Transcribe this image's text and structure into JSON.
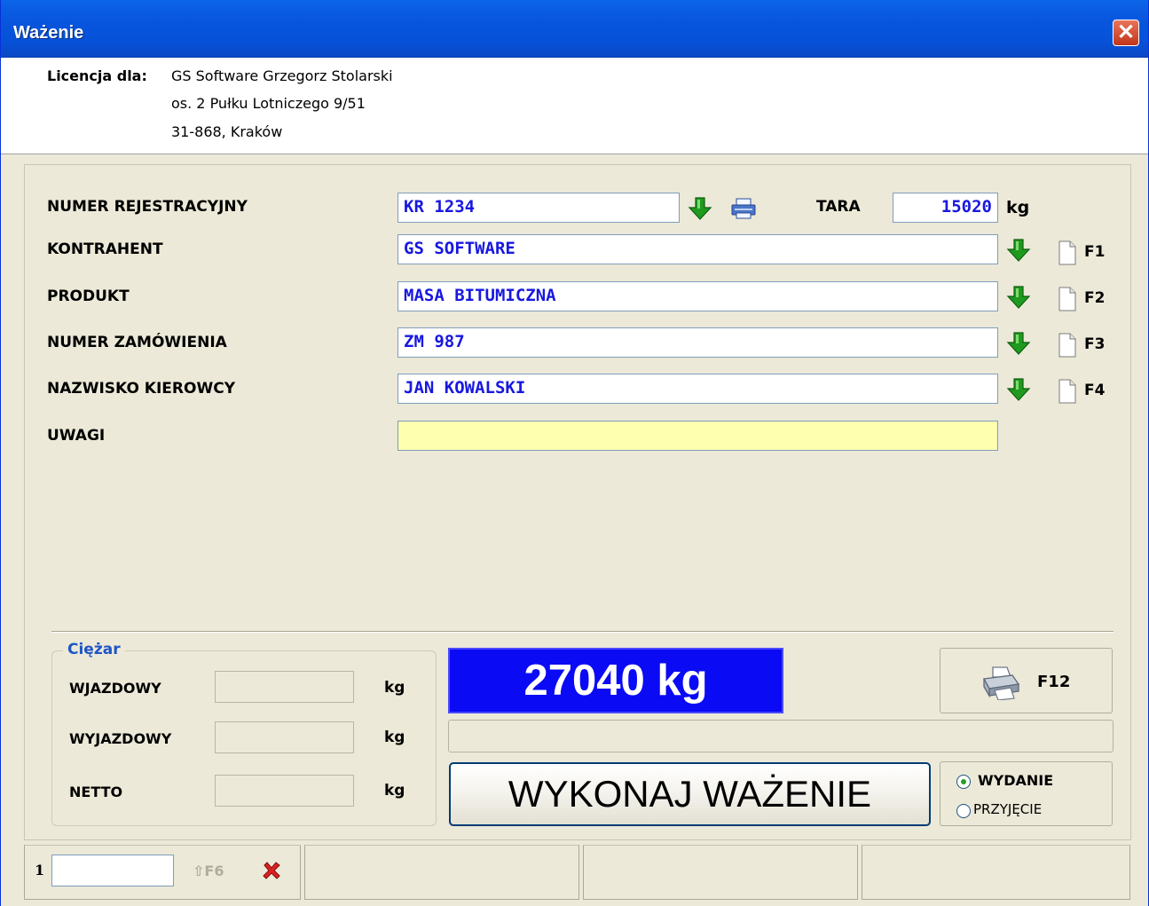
{
  "window": {
    "title": "Ważenie",
    "close_label": "✕"
  },
  "license": {
    "label": "Licencja dla:",
    "lines": [
      "GS Software Grzegorz Stolarski",
      "os. 2 Pułku Lotniczego 9/51",
      "31-868, Kraków"
    ]
  },
  "form": {
    "registration": {
      "label": "NUMER REJESTRACYJNY",
      "value": "KR 1234"
    },
    "tara": {
      "label": "TARA",
      "value": "15020",
      "unit": "kg"
    },
    "contractor": {
      "label": "KONTRAHENT",
      "value": "GS SOFTWARE",
      "key": "F1"
    },
    "product": {
      "label": "PRODUKT",
      "value": "MASA BITUMICZNA",
      "key": "F2"
    },
    "order": {
      "label": "NUMER ZAMÓWIENIA",
      "value": "ZM 987",
      "key": "F3"
    },
    "driver": {
      "label": "NAZWISKO KIEROWCY",
      "value": "JAN KOWALSKI",
      "key": "F4"
    },
    "notes": {
      "label": "UWAGI",
      "value": ""
    }
  },
  "weight": {
    "group_label": "Ciężar",
    "entry": {
      "label": "WJAZDOWY",
      "value": "",
      "unit": "kg"
    },
    "exit": {
      "label": "WYJAZDOWY",
      "value": "",
      "unit": "kg"
    },
    "net": {
      "label": "NETTO",
      "value": "",
      "unit": "kg"
    },
    "display": "27040 kg",
    "status": ""
  },
  "actions": {
    "weigh_label": "WYKONAJ WAŻENIE",
    "print_key": "F12",
    "mode_options": [
      {
        "label": "WYDANIE",
        "selected": true
      },
      {
        "label": "PRZYJĘCIE",
        "selected": false
      }
    ]
  },
  "statusbar": {
    "number": "1",
    "input_value": "",
    "f6_label": "F6",
    "panels": [
      "",
      "",
      ""
    ]
  },
  "colors": {
    "title_bar": "#0855dd",
    "field_text": "#1818e0",
    "notes_bg": "#ffffb0",
    "display_bg": "#0a0af5",
    "panel_bg": "#ece9d8",
    "arrow_green": "#1f9a1f",
    "group_label": "#1f55c7"
  },
  "icons": {
    "lookup": "green-down-arrow-icon",
    "print_small": "printer-icon",
    "new_record": "document-icon",
    "print_large": "printer-icon",
    "up": "up-arrow-icon",
    "delete": "red-x-icon"
  }
}
